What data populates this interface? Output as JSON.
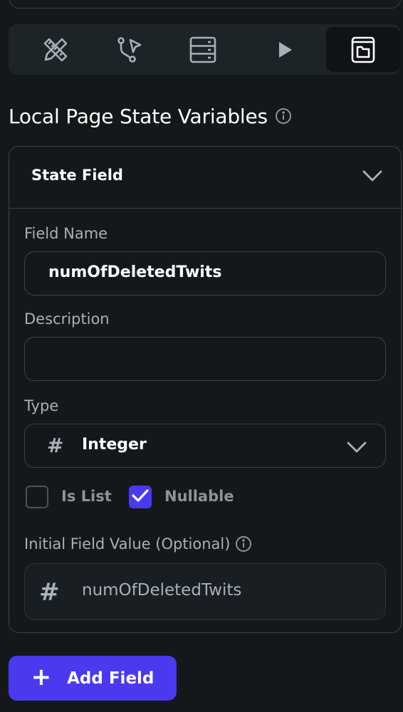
{
  "toolbar": {
    "tools": [
      {
        "icon": "ruler-pencil-icon",
        "active": false
      },
      {
        "icon": "action-flow-icon",
        "active": false
      },
      {
        "icon": "database-icon",
        "active": false
      },
      {
        "icon": "play-icon",
        "active": false
      },
      {
        "icon": "page-state-icon",
        "active": true
      }
    ]
  },
  "section": {
    "title": "Local Page State Variables"
  },
  "state_field": {
    "header": "State Field",
    "field_name_label": "Field Name",
    "field_name_value": "numOfDeletedTwits",
    "description_label": "Description",
    "description_value": "",
    "type_label": "Type",
    "type_value": "Integer",
    "is_list_label": "Is List",
    "is_list_checked": false,
    "nullable_label": "Nullable",
    "nullable_checked": true,
    "initial_value_label": "Initial Field Value (Optional)",
    "initial_value_placeholder": "numOfDeletedTwits",
    "hash_symbol": "#"
  },
  "actions": {
    "add_field_label": "Add Field",
    "add_symbol": "+"
  },
  "colors": {
    "background": "#14181b",
    "panel": "#1d2428",
    "border": "#3a424b",
    "accent": "#4b39ef",
    "muted_text": "#a8b0b9"
  }
}
